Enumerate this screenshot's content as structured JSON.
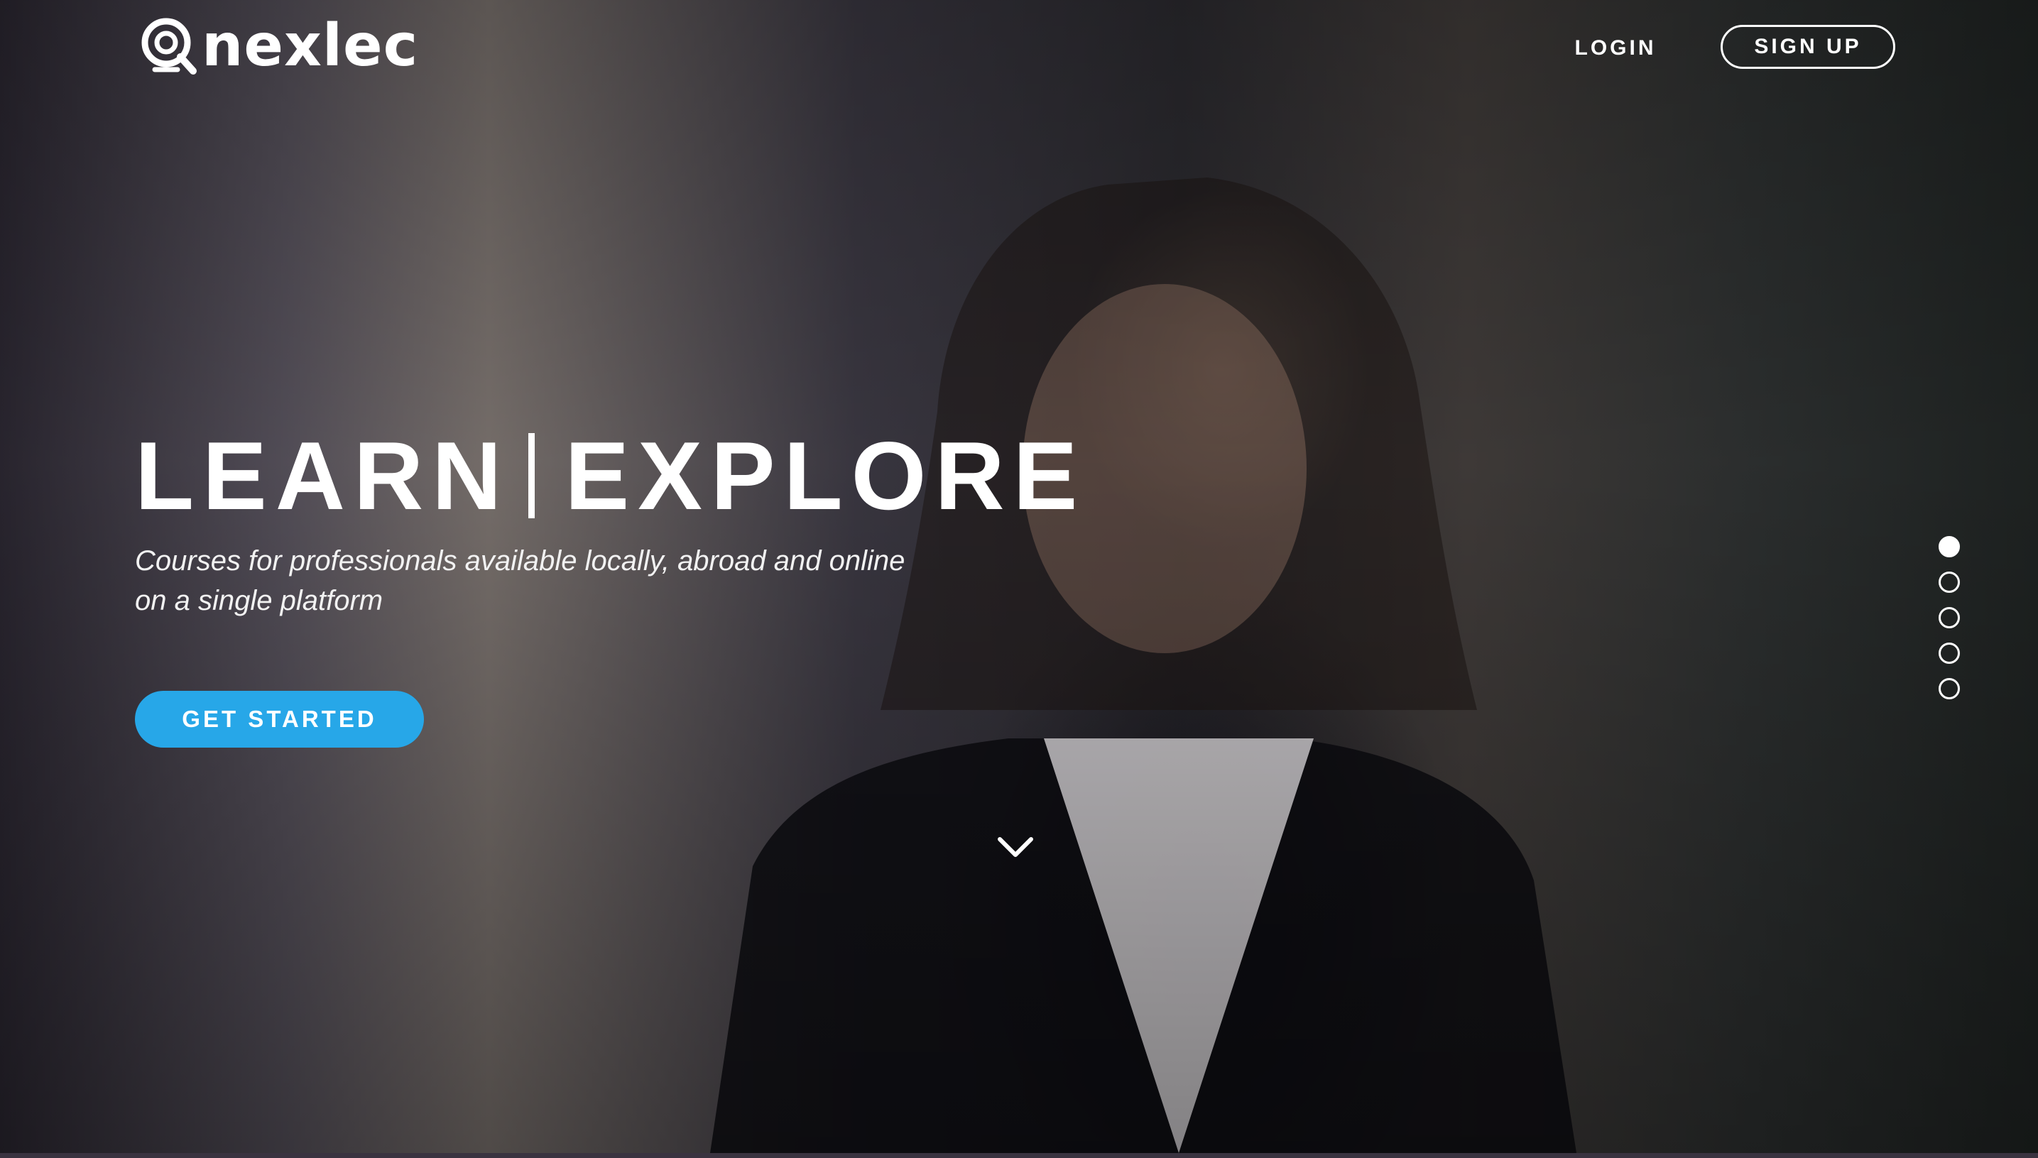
{
  "brand": {
    "name": "nexlec"
  },
  "nav": {
    "login_label": "LOGIN",
    "signup_label": "SIGN UP"
  },
  "hero": {
    "headline_left": "LEARN",
    "headline_right": "EXPLORE",
    "subtitle_line1": "Courses for professionals available locally, abroad and online",
    "subtitle_line2": "on a single platform",
    "cta_label": "GET STARTED"
  },
  "carousel": {
    "slide_count": 5,
    "active_index": 0
  },
  "colors": {
    "accent": "#27a7e8",
    "text": "#ffffff"
  },
  "icons": {
    "scroll": "chevron-down-icon",
    "logo": "logo-icon"
  }
}
